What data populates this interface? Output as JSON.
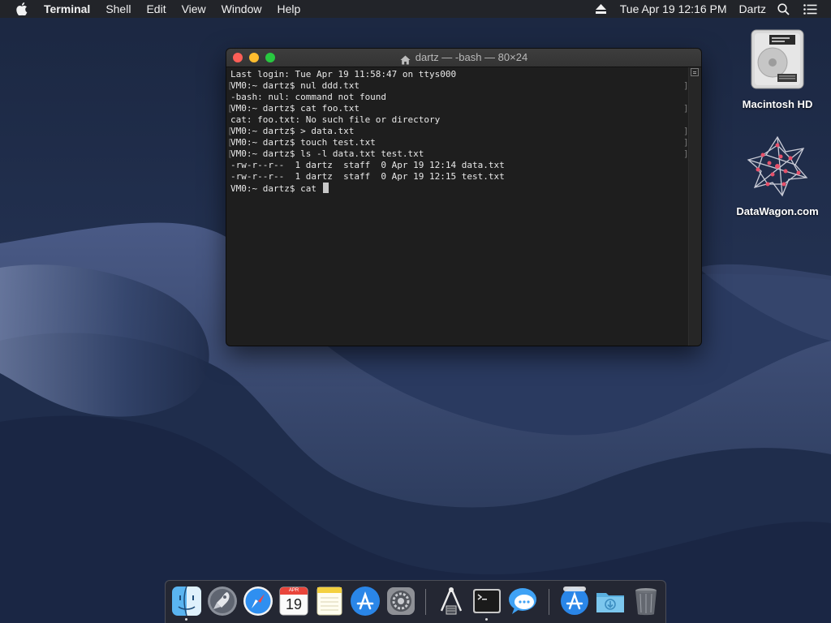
{
  "menubar": {
    "app_name": "Terminal",
    "menus": [
      "Shell",
      "Edit",
      "View",
      "Window",
      "Help"
    ],
    "clock": "Tue Apr 19  12:16 PM",
    "user": "Dartz"
  },
  "desktop_icons": [
    {
      "label": "Macintosh HD",
      "icon": "hard-drive-icon"
    },
    {
      "label": "DataWagon.com",
      "icon": "network-star-icon"
    }
  ],
  "terminal": {
    "title": "dartz — -bash — 80×24",
    "lines": [
      "Last login: Tue Apr 19 11:58:47 on ttys000",
      "VM0:~ dartz$ nul ddd.txt",
      "-bash: nul: command not found",
      "VM0:~ dartz$ cat foo.txt",
      "cat: foo.txt: No such file or directory",
      "VM0:~ dartz$ > data.txt",
      "VM0:~ dartz$ touch test.txt",
      "VM0:~ dartz$ ls -l data.txt test.txt",
      "-rw-r--r--  1 dartz  staff  0 Apr 19 12:14 data.txt",
      "-rw-r--r--  1 dartz  staff  0 Apr 19 12:15 test.txt"
    ],
    "prompt_line": "VM0:~ dartz$ cat "
  },
  "dock": {
    "apps": [
      "finder-icon",
      "launchpad-icon",
      "safari-icon",
      "calendar-icon",
      "notes-icon",
      "app-store-icon",
      "system-preferences-icon",
      "network-utility-icon",
      "terminal-icon",
      "messages-icon",
      "app-store-download-icon",
      "downloads-folder-icon",
      "trash-icon"
    ],
    "calendar_month": "APR",
    "calendar_day": "19"
  },
  "colors": {
    "menubar": "#222429",
    "terminal_bg": "#1e1e1e",
    "terminal_text": "#e8e8e8",
    "close": "#fd5f57",
    "minimize": "#febc2e",
    "zoom": "#28c840"
  }
}
